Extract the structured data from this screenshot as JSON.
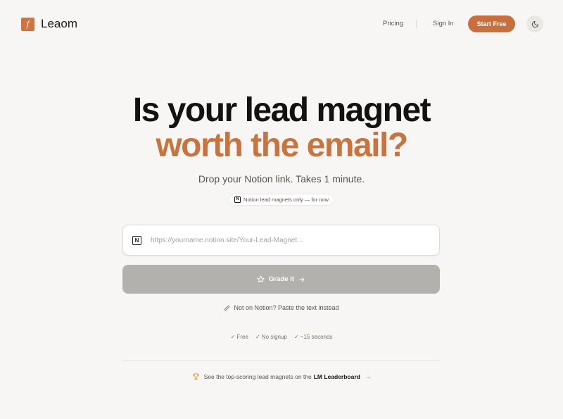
{
  "brand": {
    "logo_glyph": "f",
    "name": "Leaom",
    "accent": "#c96e3d"
  },
  "nav": {
    "pricing": "Pricing",
    "sign_in": "Sign In",
    "start_free": "Start Free",
    "theme_icon": "moon-icon"
  },
  "hero": {
    "line1": "Is your lead magnet",
    "line2": "worth the email?",
    "subtitle": "Drop your Notion link. Takes 1 minute.",
    "badge": "Notion lead magnets only — for now"
  },
  "form": {
    "input_icon": "notion-icon",
    "input_value": "",
    "input_placeholder": "https://yourname.notion.site/Your-Lead-Magnet...",
    "submit_label": "Grade it",
    "alt_link": "Not on Notion? Paste the text instead"
  },
  "features": [
    "✓ Free",
    "✓ No signup",
    "✓ ~15 seconds"
  ],
  "footer_cta": {
    "text": "See the top-scoring lead magnets on the",
    "link": "LM Leaderboard",
    "arrow": "→"
  }
}
